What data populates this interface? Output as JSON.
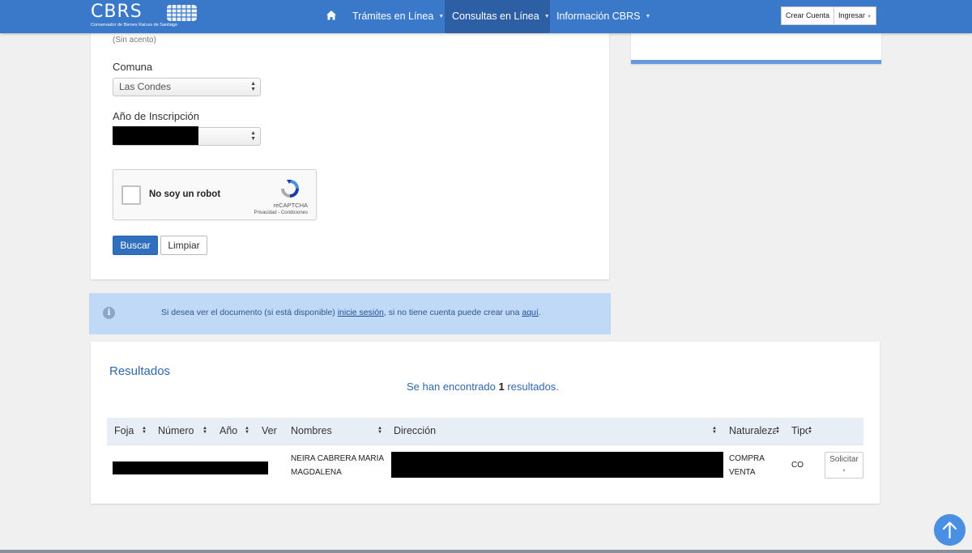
{
  "navbar": {
    "logo_text": "CBRS",
    "logo_subtitle": "Conservador de Bienes Raíces de Santiago",
    "items": [
      {
        "label": "Trámites en Línea"
      },
      {
        "label": "Consultas en Línea"
      },
      {
        "label": "Información CBRS"
      }
    ],
    "active_item": "Consultas en Línea",
    "create_account": "Crear Cuenta",
    "login": "Ingresar"
  },
  "form": {
    "name_hint": "(Sin acento)",
    "comuna_label": "Comuna",
    "comuna_value": "Las Condes",
    "anio_label": "Año de Inscripción",
    "anio_value": "",
    "captcha": {
      "label": "No soy un robot",
      "brand": "reCAPTCHA",
      "links": "Privacidad - Condiciones"
    },
    "search_button": "Buscar",
    "clear_button": "Limpiar"
  },
  "alert": {
    "text_before": "Si desea ver el documento (si está disponible) ",
    "link_login": "inicie sesión",
    "text_middle": ", si no tiene cuenta puede crear una ",
    "link_create": "aquí",
    "text_after": "."
  },
  "results": {
    "title": "Resultados",
    "count_prefix": "Se han encontrado ",
    "count": "1",
    "count_suffix": " resultados.",
    "columns": [
      "Foja",
      "Número",
      "Año",
      "Ver",
      "Nombres",
      "Dirección",
      "Naturaleza",
      "Tipo"
    ],
    "rows": [
      {
        "nombres_line1": "NEIRA CABRERA MARIA",
        "nombres_line2": "MAGDALENA",
        "naturaleza_line1": "COMPRA",
        "naturaleza_line2": "VENTA",
        "tipo": "CO",
        "action": "Solicitar"
      }
    ]
  },
  "colors": {
    "navbar": "#3a78c9",
    "navbar_active": "#2d5fa4",
    "primary_button": "#2f6fbd",
    "alert_bg": "#bfd9f7",
    "title_text": "#2f68b0"
  }
}
